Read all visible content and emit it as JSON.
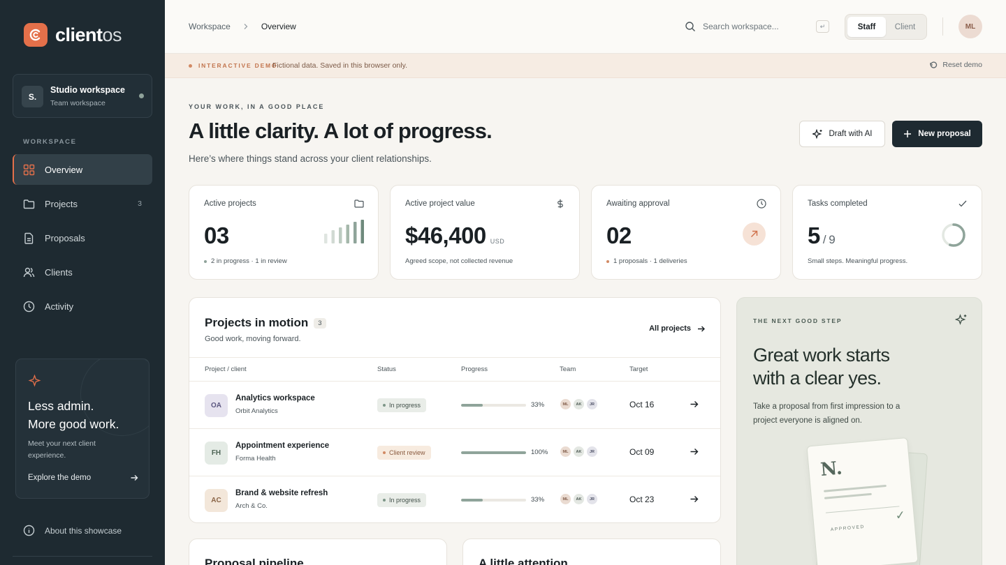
{
  "brand": {
    "name_bold": "client",
    "name_light": "os"
  },
  "workspace": {
    "initial": "S.",
    "name": "Studio workspace",
    "subtitle": "Team workspace"
  },
  "sidebar": {
    "heading": "WORKSPACE",
    "items": [
      {
        "label": "Overview",
        "icon": "grid-icon",
        "active": true
      },
      {
        "label": "Projects",
        "icon": "folder-icon",
        "count": "3"
      },
      {
        "label": "Proposals",
        "icon": "document-icon"
      },
      {
        "label": "Clients",
        "icon": "users-icon"
      },
      {
        "label": "Activity",
        "icon": "clock-icon"
      }
    ],
    "promo": {
      "title_line1": "Less admin.",
      "title_line2": "More good work.",
      "description": "Meet your next client experience.",
      "link": "Explore the demo"
    },
    "about": "About this showcase"
  },
  "header": {
    "breadcrumbs": [
      "Workspace",
      "Overview"
    ],
    "search_placeholder": "Search workspace...",
    "search_key": "↵",
    "view_toggle": [
      "Staff",
      "Client"
    ],
    "active_view": "Staff",
    "user_initials": "ML"
  },
  "demo_bar": {
    "tag": "INTERACTIVE DEMO",
    "text": "Fictional data. Saved in this browser only.",
    "reset": "Reset demo"
  },
  "hero": {
    "kicker": "YOUR WORK, IN A GOOD PLACE",
    "title": "A little clarity. A lot of progress.",
    "subtitle": "Here’s where things stand across your client relationships.",
    "ai_button": "Draft with AI",
    "new_button": "New proposal"
  },
  "stats": [
    {
      "label": "Active projects",
      "value": "03",
      "note": "2 in progress · 1 in review",
      "icon": "folder-icon"
    },
    {
      "label": "Active project value",
      "value": "$46,400",
      "unit": "USD",
      "note": "Agreed scope, not collected revenue",
      "icon": "dollar-icon"
    },
    {
      "label": "Awaiting approval",
      "value": "02",
      "note": "1 proposals · 1 deliveries",
      "icon": "clock-icon"
    },
    {
      "label": "Tasks completed",
      "value": "5",
      "of": "/ 9",
      "note": "Small steps. Meaningful progress.",
      "icon": "check-icon",
      "completed": 5,
      "total": 9
    }
  ],
  "projects": {
    "title": "Projects in motion",
    "count": "3",
    "subtitle": "Good work, moving forward.",
    "all_link": "All projects",
    "columns": [
      "Project / client",
      "Status",
      "Progress",
      "Team",
      "Target"
    ],
    "rows": [
      {
        "initials": "OA",
        "name": "Analytics workspace",
        "client": "Orbit Analytics",
        "status": "In progress",
        "status_kind": "progress",
        "progress": 33,
        "progress_label": "33%",
        "team": [
          "ML",
          "AK",
          "JR"
        ],
        "target": "Oct 16",
        "badge_bg": "#e6e3ef",
        "badge_fg": "#5b5680"
      },
      {
        "initials": "FH",
        "name": "Appointment experience",
        "client": "Forma Health",
        "status": "Client review",
        "status_kind": "review",
        "progress": 100,
        "progress_label": "100%",
        "team": [
          "ML",
          "AK",
          "JR"
        ],
        "target": "Oct 09",
        "badge_bg": "#e4ebe5",
        "badge_fg": "#4d6455"
      },
      {
        "initials": "AC",
        "name": "Brand & website refresh",
        "client": "Arch & Co.",
        "status": "In progress",
        "status_kind": "progress",
        "progress": 33,
        "progress_label": "33%",
        "team": [
          "ML",
          "AK",
          "JR"
        ],
        "target": "Oct 23",
        "badge_bg": "#f3e7da",
        "badge_fg": "#8a6446"
      }
    ]
  },
  "next_step": {
    "kicker": "THE NEXT GOOD STEP",
    "title": "Great work starts with a clear yes.",
    "description": "Take a proposal from first impression to a project everyone is aligned on.",
    "paper_mark": "N.",
    "paper_stamp": "APPROVED"
  },
  "bottom_cards": [
    "Proposal pipeline",
    "A little attention"
  ],
  "colors": {
    "accent": "#e4704a",
    "sidebar": "#1e2a31",
    "sage": "#8fa49a"
  }
}
